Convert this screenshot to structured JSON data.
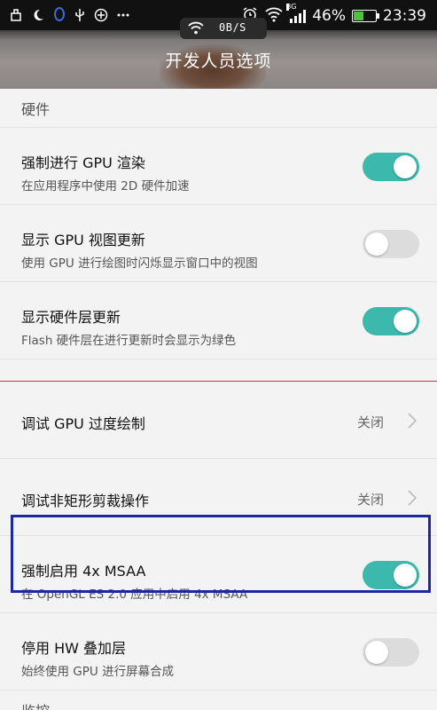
{
  "status_bar": {
    "left_icons": [
      "usb-connected-icon",
      "night-mode-icon",
      "qq-icon",
      "usb-debug-icon",
      "add-circle-icon",
      "more-dots-icon"
    ],
    "network_type": "3G",
    "battery_percent": "46%",
    "battery_level": 0.46,
    "time": "23:39"
  },
  "net_speed": {
    "text": "0B/S"
  },
  "header": {
    "title": "开发人员选项"
  },
  "sections": {
    "hardware": "硬件",
    "monitoring": "监控"
  },
  "items": [
    {
      "title": "强制进行 GPU 渲染",
      "subtitle": "在应用程序中使用 2D 硬件加速",
      "state": "on"
    },
    {
      "title": "显示 GPU 视图更新",
      "subtitle": "使用 GPU 进行绘图时闪烁显示窗口中的视图",
      "state": "off"
    },
    {
      "title": "显示硬件层更新",
      "subtitle": "Flash 硬件层在进行更新时会显示为绿色",
      "state": "on"
    },
    {
      "title": "调试 GPU 过度绘制",
      "value": "关闭"
    },
    {
      "title": "调试非矩形剪裁操作",
      "value": "关闭"
    },
    {
      "title": "强制启用 4x MSAA",
      "subtitle": "在 OpenGL ES 2.0 应用中启用 4x MSAA",
      "state": "on"
    },
    {
      "title": "停用 HW 叠加层",
      "subtitle": "始终使用 GPU 进行屏幕合成",
      "state": "off"
    }
  ],
  "colors": {
    "toggle_on": "#3cb8ad",
    "toggle_off": "#dcdcdc",
    "highlight_border": "#1a2a9a",
    "divider_red": "#c9382e"
  }
}
